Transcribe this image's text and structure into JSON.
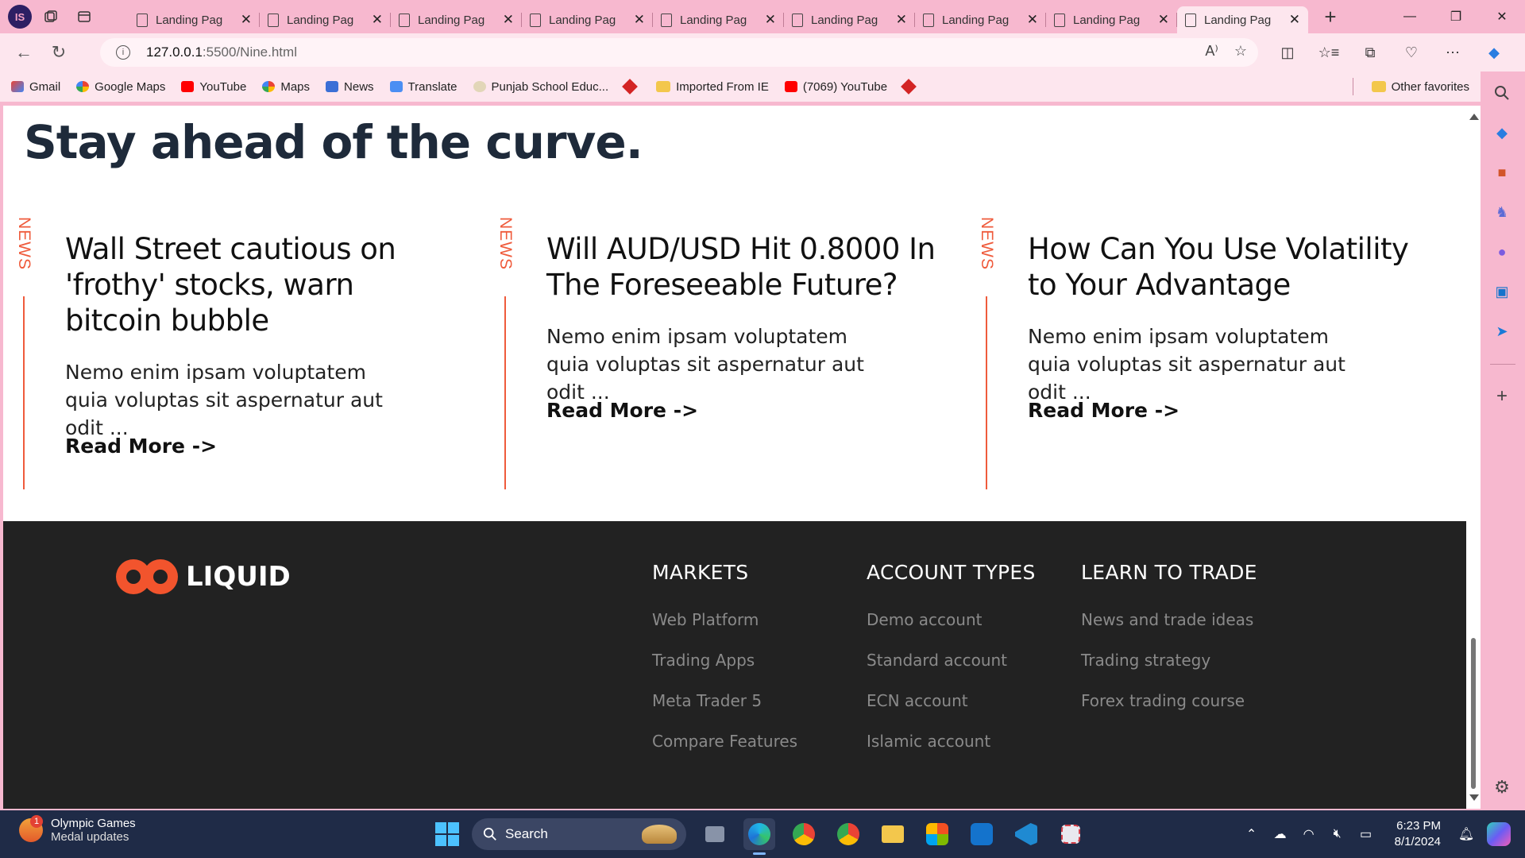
{
  "browser": {
    "profile_initials": "IS",
    "tabs": [
      {
        "title": "Landing Pag",
        "active": false
      },
      {
        "title": "Landing Pag",
        "active": false
      },
      {
        "title": "Landing Pag",
        "active": false
      },
      {
        "title": "Landing Pag",
        "active": false
      },
      {
        "title": "Landing Pag",
        "active": false
      },
      {
        "title": "Landing Pag",
        "active": false
      },
      {
        "title": "Landing Pag",
        "active": false
      },
      {
        "title": "Landing Pag",
        "active": false
      },
      {
        "title": "Landing Pag",
        "active": true
      }
    ],
    "url_host": "127.0.0.1",
    "url_rest": ":5500/Nine.html"
  },
  "favorites": {
    "items": [
      {
        "label": "Gmail",
        "icon": "gmail-icon"
      },
      {
        "label": "Google Maps",
        "icon": "google-icon"
      },
      {
        "label": "YouTube",
        "icon": "youtube-icon"
      },
      {
        "label": "Maps",
        "icon": "google-icon"
      },
      {
        "label": "News",
        "icon": "news-icon"
      },
      {
        "label": "Translate",
        "icon": "translate-icon"
      },
      {
        "label": "Punjab School Educ...",
        "icon": "pseb-icon"
      }
    ],
    "folder": "Imported From IE",
    "youtube2": "(7069) YouTube",
    "other": "Other favorites"
  },
  "page": {
    "headline": "Stay ahead of the curve.",
    "news_label": "NEWS",
    "cards": [
      {
        "title": "Wall Street cautious on 'frothy' stocks, warn bitcoin bubble",
        "body": "Nemo enim ipsam voluptatem quia voluptas sit aspernatur aut odit ...",
        "link": "Read More ->"
      },
      {
        "title": "Will AUD/USD Hit 0.8000 In The Foreseeable Future?",
        "body": "Nemo enim ipsam voluptatem quia voluptas sit aspernatur aut odit ...",
        "link": "Read More ->"
      },
      {
        "title": "How Can You Use Volatility to Your Advantage",
        "body": "Nemo enim ipsam voluptatem quia voluptas sit aspernatur aut odit ...",
        "link": "Read More ->"
      }
    ]
  },
  "footer": {
    "brand": "LIQUID",
    "columns": [
      {
        "heading": "MARKETS",
        "links": [
          "Web Platform",
          "Trading Apps",
          "Meta Trader 5",
          "Compare Features"
        ]
      },
      {
        "heading": "ACCOUNT TYPES",
        "links": [
          "Demo account",
          "Standard account",
          "ECN account",
          "Islamic account"
        ]
      },
      {
        "heading": "LEARN TO TRADE",
        "links": [
          "News and trade ideas",
          "Trading strategy",
          "Forex trading course"
        ]
      }
    ]
  },
  "taskbar": {
    "weather_badge": "1",
    "weather_title": "Olympic Games",
    "weather_sub": "Medal updates",
    "search_label": "Search",
    "time": "6:23 PM",
    "date": "8/1/2024"
  },
  "colors": {
    "accent": "#f2542d",
    "news_red": "#ef5b3c",
    "footer_bg": "#222222",
    "browser_chrome": "#f7b8cf",
    "headline": "#1e2a3a"
  }
}
